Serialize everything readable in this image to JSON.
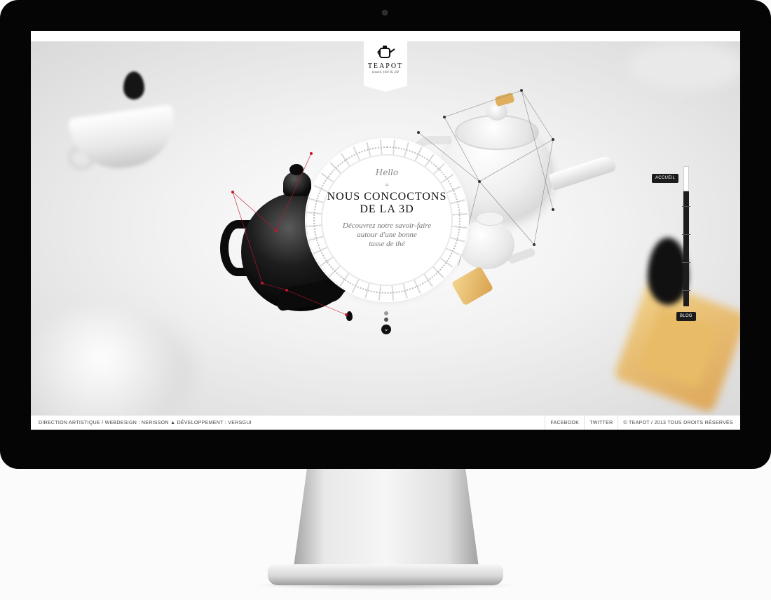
{
  "logo": {
    "title": "TEAPOT",
    "tagline": "toast, thé & 3d"
  },
  "hero": {
    "greeting": "Hello",
    "divider": "≈",
    "headline_line1": "NOUS CONCOCTONS",
    "headline_line2": "DE LA 3D",
    "subtitle_line1": "Découvrez notre savoir-faire",
    "subtitle_line2": "autour d'une bonne",
    "subtitle_line3": "tasse de thé"
  },
  "timeline": {
    "start_label": "ACCUEIL",
    "end_label": "BLOG",
    "progress": 0.18
  },
  "pager": {
    "dots": 2,
    "active_index": 0,
    "scroll_icon": "chevron-down-icon"
  },
  "footer": {
    "credits": "DIRECTION ARTISTIQUE / WEBDESIGN : NERISSON ▲ DÉVELOPPEMENT : VERSGUI",
    "facebook": "FACEBOOK",
    "twitter": "TWITTER",
    "copyright": "© TEAPOT / 2013 TOUS DROITS RÉSERVÉS"
  },
  "colors": {
    "ink": "#111111",
    "accent_red": "#c4162b",
    "biscuit": "#e0ad5b",
    "frame": "#050505"
  }
}
